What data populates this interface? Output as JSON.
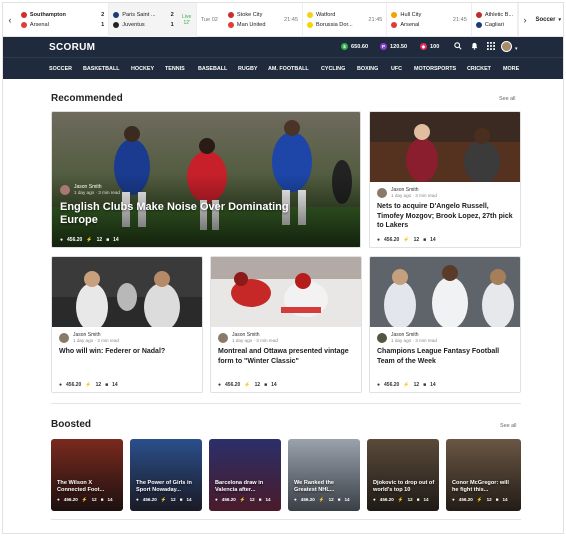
{
  "ticker": {
    "matches": [
      {
        "home": "Southampton",
        "away": "Arsenal",
        "home_score": "2",
        "away_score": "1"
      },
      {
        "home": "Paris Saint ...",
        "away": "Juventus",
        "home_score": "2",
        "away_score": "1",
        "status": "Live 12'"
      },
      {
        "date": "Tue 02",
        "home": "Stoke City",
        "away": "Man United",
        "time": "21:45"
      },
      {
        "home": "Watford",
        "away": "Borussia Dor...",
        "time": "21:45"
      },
      {
        "home": "Hull City",
        "away": "Arsenal",
        "time": "21:45"
      },
      {
        "home": "Athletic B...",
        "away": "Cagliari"
      }
    ],
    "sport_select": "Soccer"
  },
  "header": {
    "logo": "SCORUM",
    "balances": [
      {
        "icon": "dollar-coin-icon",
        "value": "650.60",
        "color": "#2fae49"
      },
      {
        "icon": "p-coin-icon",
        "value": "120.50",
        "color": "#8a3fd1"
      },
      {
        "icon": "crystal-coin-icon",
        "value": "100",
        "color": "#e3305a"
      }
    ]
  },
  "nav": [
    "SOCCER",
    "BASKETBALL",
    "HOCKEY",
    "TENNIS",
    "BASEBALL",
    "RUGBY",
    "AM. FOOTBALL",
    "CYCLING",
    "BOXING",
    "UFC",
    "MOTORSPORTS",
    "CRICKET",
    "MORE"
  ],
  "recommended": {
    "title": "Recommended",
    "see_all": "See all",
    "hero": {
      "author": "Jason Smith",
      "time": "1 day ago · 3 min read",
      "title": "English Clubs Make Noise Over Dominating Europe",
      "payout": "456.20",
      "votes": "12",
      "comments": "14"
    },
    "cards": [
      {
        "author": "Jason Smith",
        "time": "1 day ago · 3 min read",
        "title": "Nets to acquire D'Angelo Russell, Timofey Mozgov; Brook Lopez, 27th pick to Lakers",
        "payout": "456.20",
        "votes": "12",
        "comments": "14"
      },
      {
        "author": "Jason Smith",
        "time": "1 day ago · 3 min read",
        "title": "Who will win: Federer or Nadal?",
        "payout": "456.20",
        "votes": "12",
        "comments": "14"
      },
      {
        "author": "Jason Smith",
        "time": "1 day ago · 3 min read",
        "title": "Montreal and Ottawa presented vintage form to \"Winter Classic\"",
        "payout": "456.20",
        "votes": "12",
        "comments": "14"
      },
      {
        "author": "Jason Smith",
        "time": "1 day ago · 3 min read",
        "title": "Champions League Fantasy Football Team of the Week",
        "payout": "456.20",
        "votes": "12",
        "comments": "14"
      }
    ]
  },
  "boosted": {
    "title": "Boosted",
    "see_all": "See all",
    "items": [
      {
        "title": "The Wilson X Connected Foot...",
        "payout": "456.20",
        "votes": "12",
        "comments": "14"
      },
      {
        "title": "The Power of Girls in Sport Nowaday...",
        "payout": "456.20",
        "votes": "12",
        "comments": "14"
      },
      {
        "title": "Barcelona draw in Valencia after...",
        "payout": "456.20",
        "votes": "12",
        "comments": "14"
      },
      {
        "title": "We Ranked the Greatest NHL...",
        "payout": "456.20",
        "votes": "12",
        "comments": "14"
      },
      {
        "title": "Djokovic to drop out of world's top 10",
        "payout": "456.20",
        "votes": "12",
        "comments": "14"
      },
      {
        "title": "Conor McGregor: will he fight this...",
        "payout": "456.20",
        "votes": "12",
        "comments": "14"
      }
    ]
  }
}
